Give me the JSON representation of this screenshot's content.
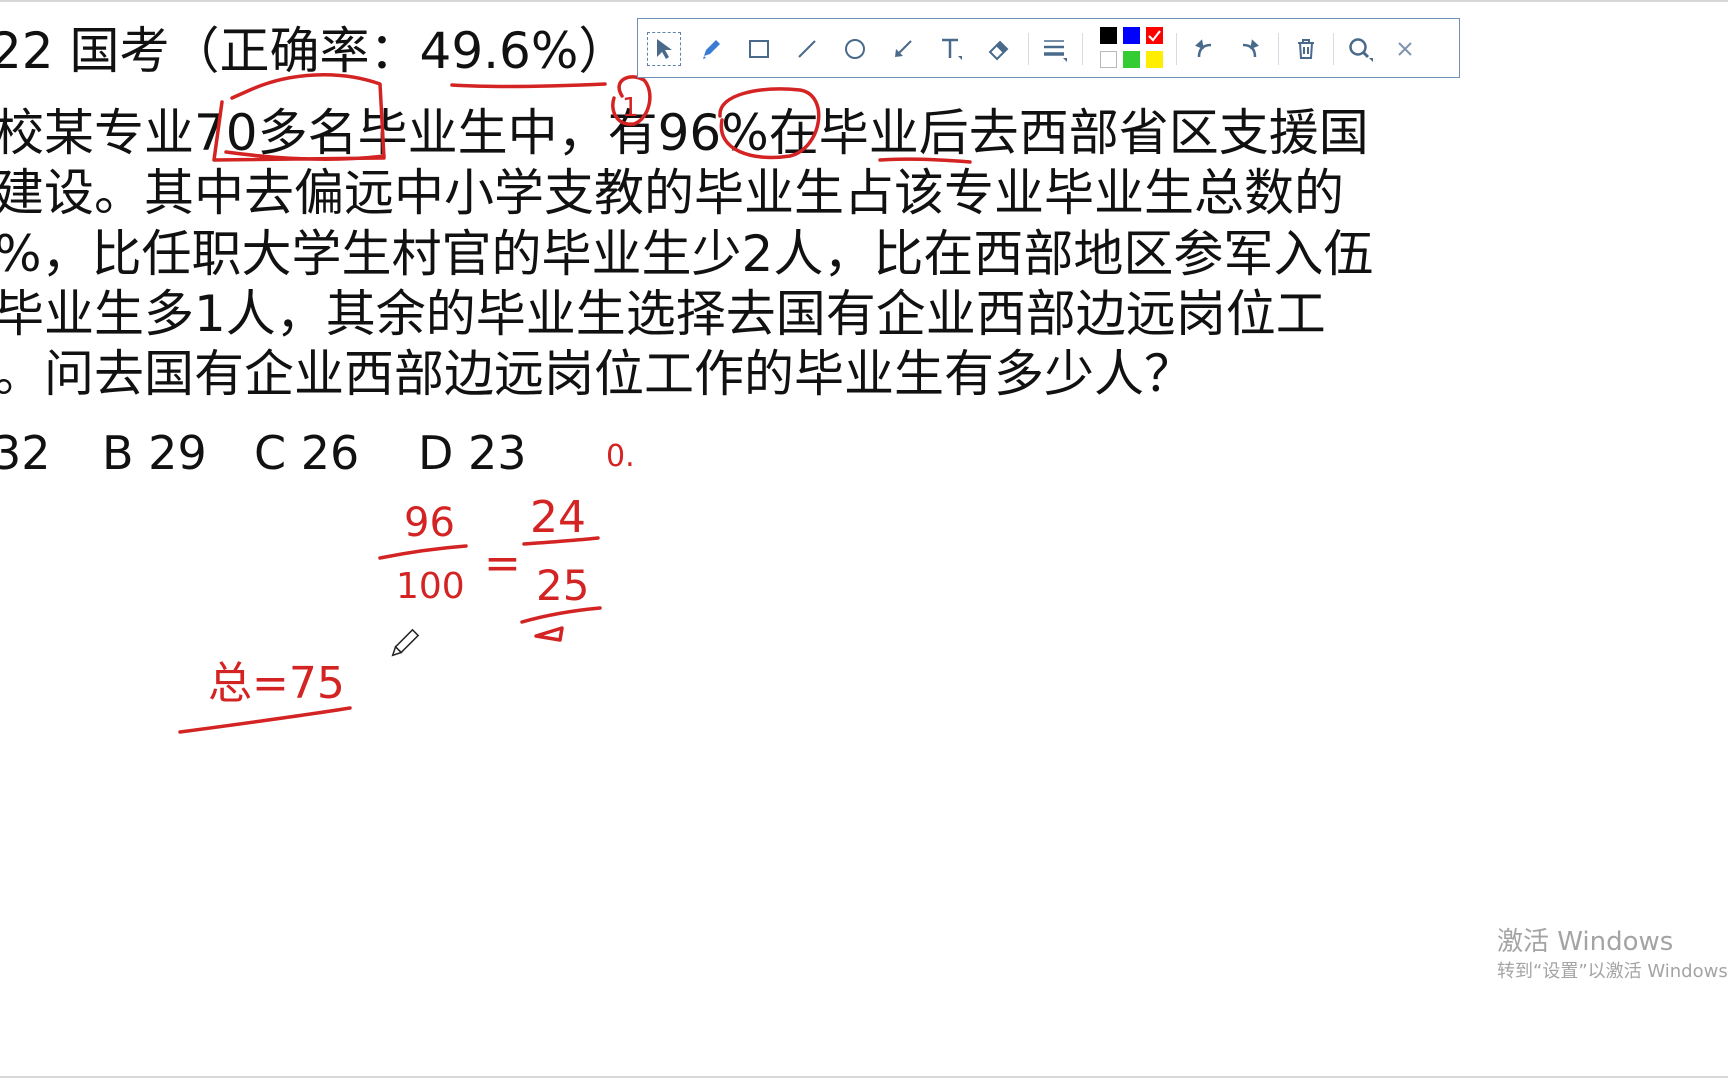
{
  "slide": {
    "title": "22 国考（正确率：49.6%）",
    "question_lines": [
      "校某专业70多名毕业生中，有96%在毕业后去西部省区支援国",
      "建设。其中去偏远中小学支教的毕业生占该专业毕业生总数的",
      "%，比任职大学生村官的毕业生少2人，比在西部地区参军入伍",
      "毕业生多1人，其余的毕业生选择去国有企业西部边远岗位工",
      "。问去国有企业西部边远岗位工作的毕业生有多少人？"
    ],
    "options": {
      "a": "32",
      "b": "B 29",
      "c": "C 26",
      "d": "D 23"
    }
  },
  "handwriting": {
    "circle_number": "1",
    "fragment": "0.",
    "fraction_left_numerator": "96",
    "fraction_left_denominator": "100",
    "equals": "=",
    "fraction_right_numerator": "24",
    "fraction_right_denominator": "25",
    "total": "总=75"
  },
  "toolbar": {
    "tools": [
      "pointer-icon",
      "pen-icon",
      "rectangle-icon",
      "line-icon",
      "circle-icon",
      "arrow-icon",
      "text-icon",
      "eraser-icon",
      "line-width-icon"
    ],
    "colors": [
      "#000000",
      "#0000ff",
      "#ff0000",
      "#ffffff",
      "#33cc33",
      "#ffee00"
    ],
    "selected_color": "#ff0000",
    "actions": [
      "undo-icon",
      "redo-icon",
      "trash-icon",
      "zoom-icon",
      "close-icon"
    ]
  },
  "watermark": {
    "line1": "激活 Windows",
    "line2": "转到“设置”以激活 Windows。"
  },
  "accent": {
    "ink": "#d42323",
    "toolbar_border": "#6f8fb5",
    "toolbar_icon": "#4a6a8c"
  }
}
